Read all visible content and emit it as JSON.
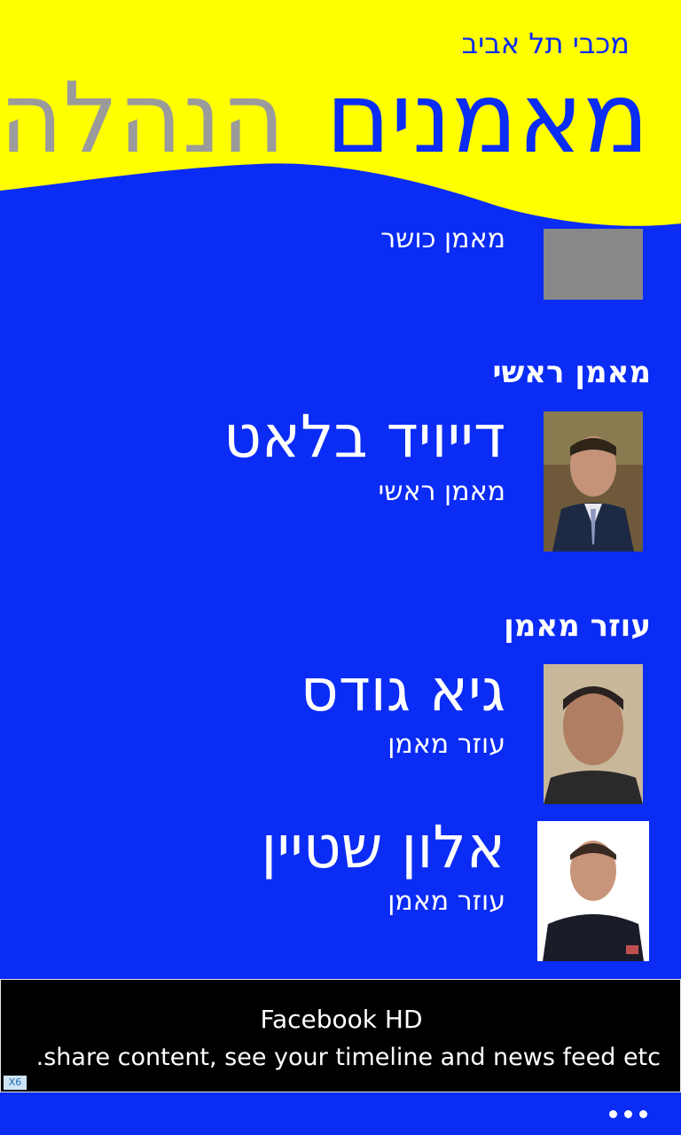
{
  "app": {
    "title": "מכבי תל אביב",
    "pivot_active": "מאמנים",
    "pivot_next": "הנהלה"
  },
  "sections": {
    "conditioning": {
      "role": "מאמן כושר"
    },
    "head_coach": {
      "header": "מאמן ראשי",
      "name": "דייויד בלאט",
      "role": "מאמן ראשי"
    },
    "assistant": {
      "header": "עוזר מאמן",
      "items": [
        {
          "name": "גיא גודס",
          "role": "עוזר מאמן"
        },
        {
          "name": "אלון שטיין",
          "role": "עוזר מאמן"
        }
      ]
    }
  },
  "ad": {
    "title": "Facebook HD",
    "description": ".share content, see your timeline and news feed etc",
    "badge": "X6"
  },
  "appbar": {
    "more_icon": "ellipsis-icon"
  },
  "colors": {
    "background": "#0a2cf5",
    "header": "#ffff00",
    "pivot_inactive": "#9b9b9b",
    "placeholder": "#888888"
  }
}
